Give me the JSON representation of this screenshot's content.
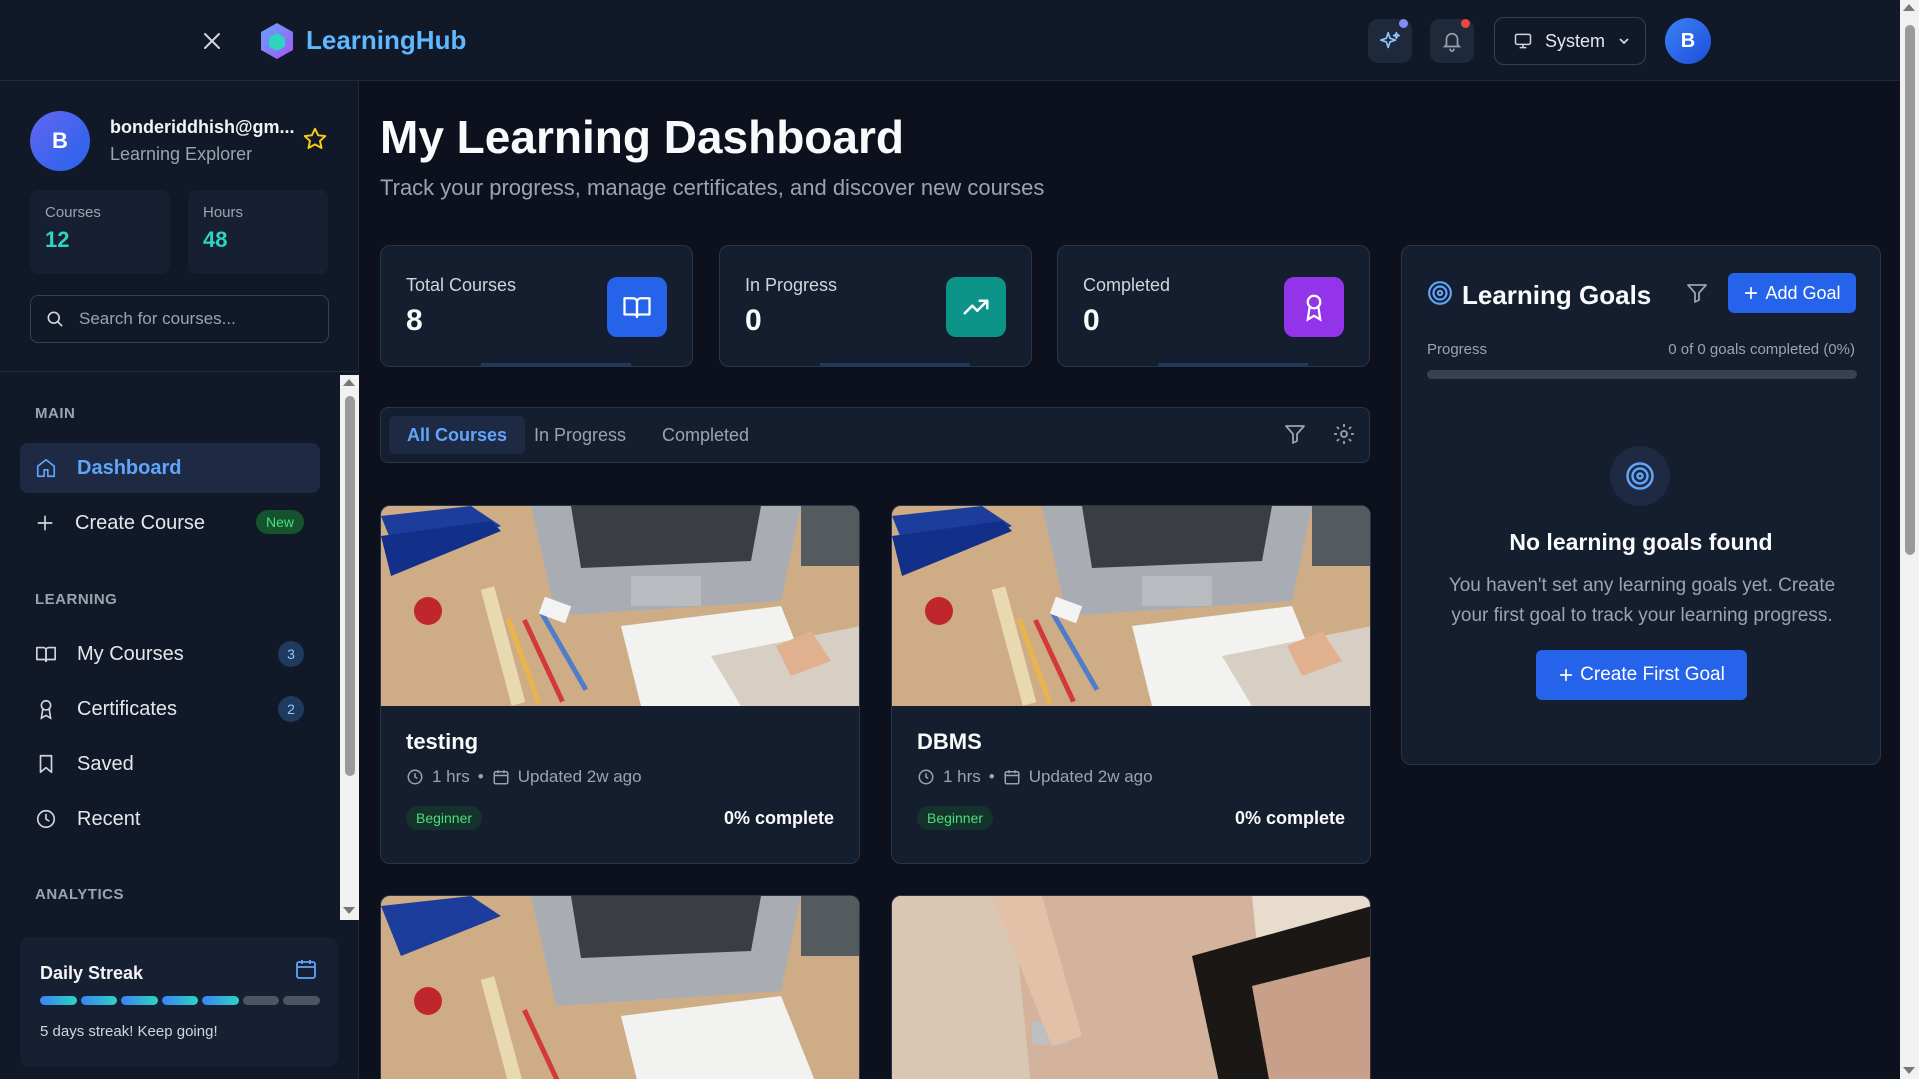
{
  "header": {
    "brand": "LearningHub",
    "theme_label": "System",
    "avatar_initial": "B",
    "accent": "#5eb8ff"
  },
  "sidebar": {
    "user": {
      "initial": "B",
      "email": "bonderiddhish@gm...",
      "role": "Learning Explorer"
    },
    "stats": [
      {
        "label": "Courses",
        "value": "12"
      },
      {
        "label": "Hours",
        "value": "48"
      }
    ],
    "search_placeholder": "Search for courses...",
    "sections": {
      "main": "MAIN",
      "learning": "LEARNING",
      "analytics": "ANALYTICS"
    },
    "items": {
      "dashboard": "Dashboard",
      "create_course": "Create Course",
      "create_course_badge": "New",
      "my_courses": "My Courses",
      "my_courses_count": "3",
      "certificates": "Certificates",
      "certificates_count": "2",
      "saved": "Saved",
      "recent": "Recent"
    },
    "streak": {
      "title": "Daily Streak",
      "days": 5,
      "total": 7,
      "text": "5 days streak! Keep going!"
    }
  },
  "main": {
    "title": "My Learning Dashboard",
    "subtitle": "Track your progress, manage certificates, and discover new courses",
    "stats": [
      {
        "label": "Total Courses",
        "value": "8",
        "icon": "book-icon",
        "color": "#2563eb"
      },
      {
        "label": "In Progress",
        "value": "0",
        "icon": "trending-up-icon",
        "color": "#0d9488"
      },
      {
        "label": "Completed",
        "value": "0",
        "icon": "award-icon",
        "color": "#9333ea"
      }
    ],
    "tabs": [
      {
        "label": "All Courses",
        "active": true
      },
      {
        "label": "In Progress",
        "active": false
      },
      {
        "label": "Completed",
        "active": false
      }
    ],
    "courses": [
      {
        "title": "testing",
        "duration": "1 hrs",
        "updated": "Updated 2w ago",
        "level": "Beginner",
        "progress": "0% complete"
      },
      {
        "title": "DBMS",
        "duration": "1 hrs",
        "updated": "Updated 2w ago",
        "level": "Beginner",
        "progress": "0% complete"
      }
    ]
  },
  "goals": {
    "title": "Learning Goals",
    "add_label": "Add Goal",
    "progress_label": "Progress",
    "progress_text": "0 of 0 goals completed (0%)",
    "progress_fraction": 0,
    "empty_title": "No learning goals found",
    "empty_text": "You haven't set any learning goals yet. Create your first goal to track your learning progress.",
    "create_label": "Create First Goal"
  }
}
